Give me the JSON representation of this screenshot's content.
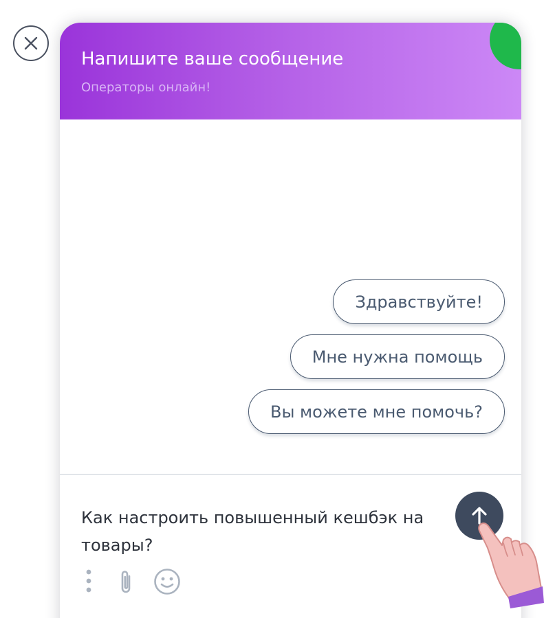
{
  "header": {
    "title": "Напишите ваше сообщение",
    "subtitle": "Операторы онлайн!",
    "gradient_start": "#9a34da",
    "gradient_end": "#cc88f6",
    "status_color": "#1fb84b"
  },
  "quick_replies": [
    {
      "label": "Здравствуйте!"
    },
    {
      "label": "Мне нужна помощь"
    },
    {
      "label": "Вы можете мне помочь?"
    }
  ],
  "composer": {
    "message_text": "Как настроить повышенный кешбэк на товары?",
    "send_button_color": "#3e4a5e"
  },
  "icons": {
    "close": "close-icon",
    "more": "more-vertical-icon",
    "attach": "paperclip-icon",
    "emoji": "smiley-icon",
    "send": "arrow-up-icon",
    "cursor": "pointing-hand-icon"
  }
}
